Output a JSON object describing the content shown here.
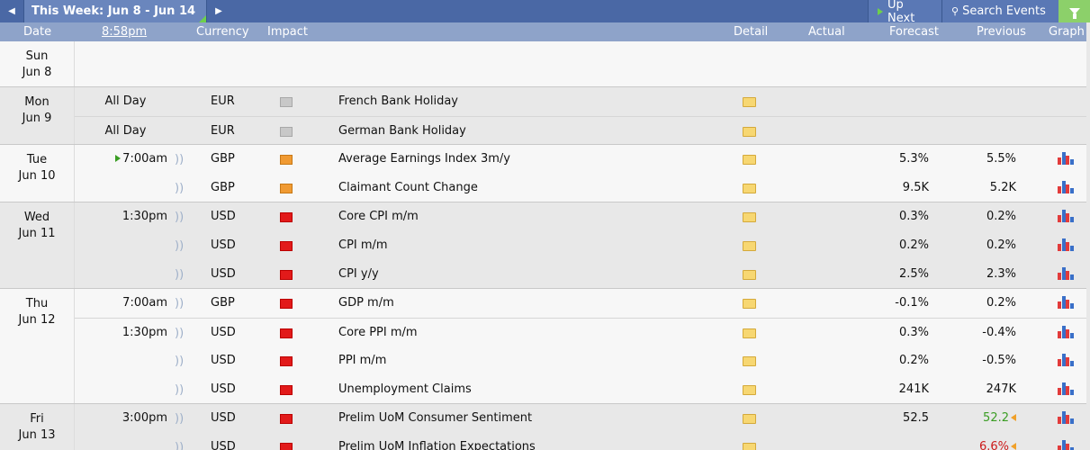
{
  "toolbar": {
    "prev_icon": "◀",
    "next_icon": "▶",
    "week_title": "This Week: Jun 8 - Jun 14",
    "up_next": "Up Next",
    "search_icon": "🔍",
    "search_events": "Search Events",
    "filter_icon": "filter-icon"
  },
  "columns": {
    "date": "Date",
    "time": "8:58pm",
    "currency": "Currency",
    "impact": "Impact",
    "detail": "Detail",
    "actual": "Actual",
    "forecast": "Forecast",
    "previous": "Previous",
    "graph": "Graph"
  },
  "colors": {
    "topbar": "#4a68a5",
    "header": "#8ea3c9",
    "row_alt": "#e8e8e8",
    "impact_high": "#e21a1a",
    "impact_medium": "#f09a32",
    "impact_holiday": "#c8c8c8",
    "better": "#3a9d23",
    "worse": "#cc1b1b"
  },
  "days": [
    {
      "dow": "Sun",
      "date": "Jun 8",
      "events": []
    },
    {
      "dow": "Mon",
      "date": "Jun 9",
      "events": [
        {
          "time": "All Day",
          "currency": "EUR",
          "impact": "holiday",
          "name": "French Bank Holiday",
          "forecast": "",
          "previous": ""
        },
        {
          "time": "All Day",
          "currency": "EUR",
          "impact": "holiday",
          "name": "German Bank Holiday",
          "forecast": "",
          "previous": ""
        }
      ]
    },
    {
      "dow": "Tue",
      "date": "Jun 10",
      "events": [
        {
          "time": "7:00am",
          "currency": "GBP",
          "impact": "medium",
          "name": "Average Earnings Index 3m/y",
          "forecast": "5.3%",
          "previous": "5.5%",
          "next": true
        },
        {
          "time": "",
          "currency": "GBP",
          "impact": "medium",
          "name": "Claimant Count Change",
          "forecast": "9.5K",
          "previous": "5.2K"
        }
      ]
    },
    {
      "dow": "Wed",
      "date": "Jun 11",
      "events": [
        {
          "time": "1:30pm",
          "currency": "USD",
          "impact": "high",
          "name": "Core CPI m/m",
          "forecast": "0.3%",
          "previous": "0.2%"
        },
        {
          "time": "",
          "currency": "USD",
          "impact": "high",
          "name": "CPI m/m",
          "forecast": "0.2%",
          "previous": "0.2%"
        },
        {
          "time": "",
          "currency": "USD",
          "impact": "high",
          "name": "CPI y/y",
          "forecast": "2.5%",
          "previous": "2.3%"
        }
      ]
    },
    {
      "dow": "Thu",
      "date": "Jun 12",
      "events": [
        {
          "time": "7:00am",
          "currency": "GBP",
          "impact": "high",
          "name": "GDP m/m",
          "forecast": "-0.1%",
          "previous": "0.2%"
        },
        {
          "time": "1:30pm",
          "currency": "USD",
          "impact": "high",
          "name": "Core PPI m/m",
          "forecast": "0.3%",
          "previous": "-0.4%"
        },
        {
          "time": "",
          "currency": "USD",
          "impact": "high",
          "name": "PPI m/m",
          "forecast": "0.2%",
          "previous": "-0.5%"
        },
        {
          "time": "",
          "currency": "USD",
          "impact": "high",
          "name": "Unemployment Claims",
          "forecast": "241K",
          "previous": "247K"
        }
      ]
    },
    {
      "dow": "Fri",
      "date": "Jun 13",
      "events": [
        {
          "time": "3:00pm",
          "currency": "USD",
          "impact": "high",
          "name": "Prelim UoM Consumer Sentiment",
          "forecast": "52.5",
          "previous": "52.2",
          "prev_color": "green"
        },
        {
          "time": "",
          "currency": "USD",
          "impact": "high",
          "name": "Prelim UoM Inflation Expectations",
          "forecast": "",
          "previous": "6.6%",
          "prev_color": "red"
        }
      ]
    }
  ]
}
